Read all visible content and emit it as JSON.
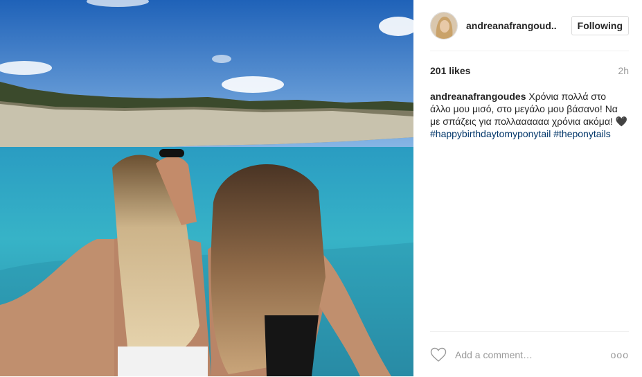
{
  "post": {
    "photo_icon": "photo-two-girls-by-the-sea"
  },
  "header": {
    "username": "andreanafrangoud..",
    "follow_label": "Following",
    "avatar_icon": "profile-avatar"
  },
  "stats": {
    "likes": "201 likes",
    "time": "2h"
  },
  "caption": {
    "username": "andreanafrangoudes",
    "text": "Χρόνια πολλά στο άλλο μου μισό, στο μεγάλο μου βάσανο! Να με σπάζεις για πολλαααααα χρόνια ακόμα!",
    "emoji": "🖤",
    "hashtag_1": "#happybirthdaytomyponytail",
    "hashtag_2": "#theponytails"
  },
  "footer": {
    "comment_placeholder": "Add a comment…",
    "more_label": "ooo",
    "like_icon": "heart-outline"
  },
  "colors": {
    "link": "#003569",
    "muted": "#999999",
    "border": "#dbdbdb"
  }
}
